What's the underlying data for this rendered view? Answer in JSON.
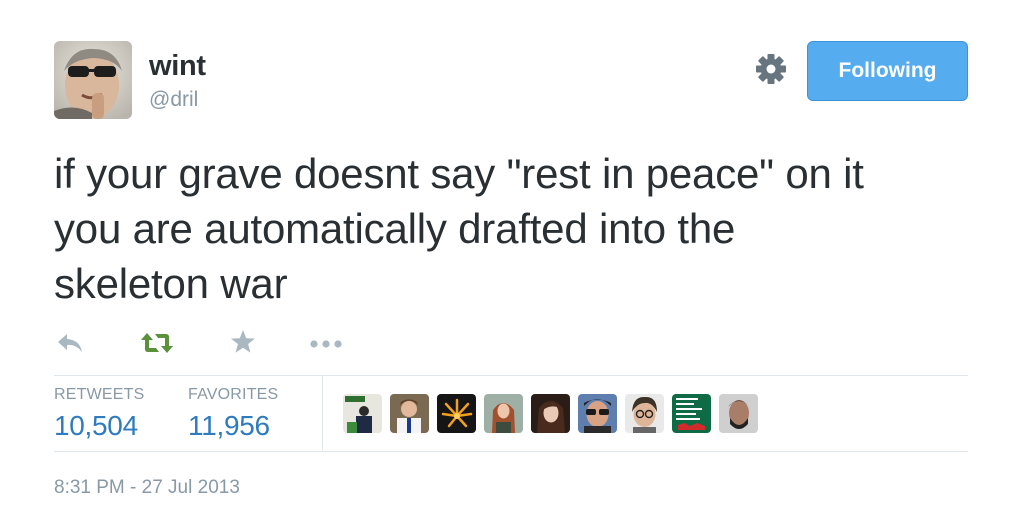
{
  "author": {
    "name": "wint",
    "handle": "@dril"
  },
  "follow_button": {
    "label": "Following",
    "color": "#55acee"
  },
  "tweet": {
    "lines": [
      "if your grave doesnt say \"rest in peace\" on it",
      "you are automatically drafted into the",
      "skeleton war"
    ]
  },
  "actions": [
    {
      "name": "reply-icon",
      "color": "#aab8c2"
    },
    {
      "name": "retweet-icon",
      "color": "#5c913b"
    },
    {
      "name": "favorite-icon",
      "color": "#aab8c2"
    },
    {
      "name": "more-icon",
      "color": "#aab8c2"
    }
  ],
  "stats": {
    "retweets_label": "RETWEETS",
    "retweets_value": "10,504",
    "favorites_label": "FAVORITES",
    "favorites_value": "11,956"
  },
  "favoriters_count_shown": 9,
  "timestamp": "8:31 PM - 27 Jul 2013"
}
